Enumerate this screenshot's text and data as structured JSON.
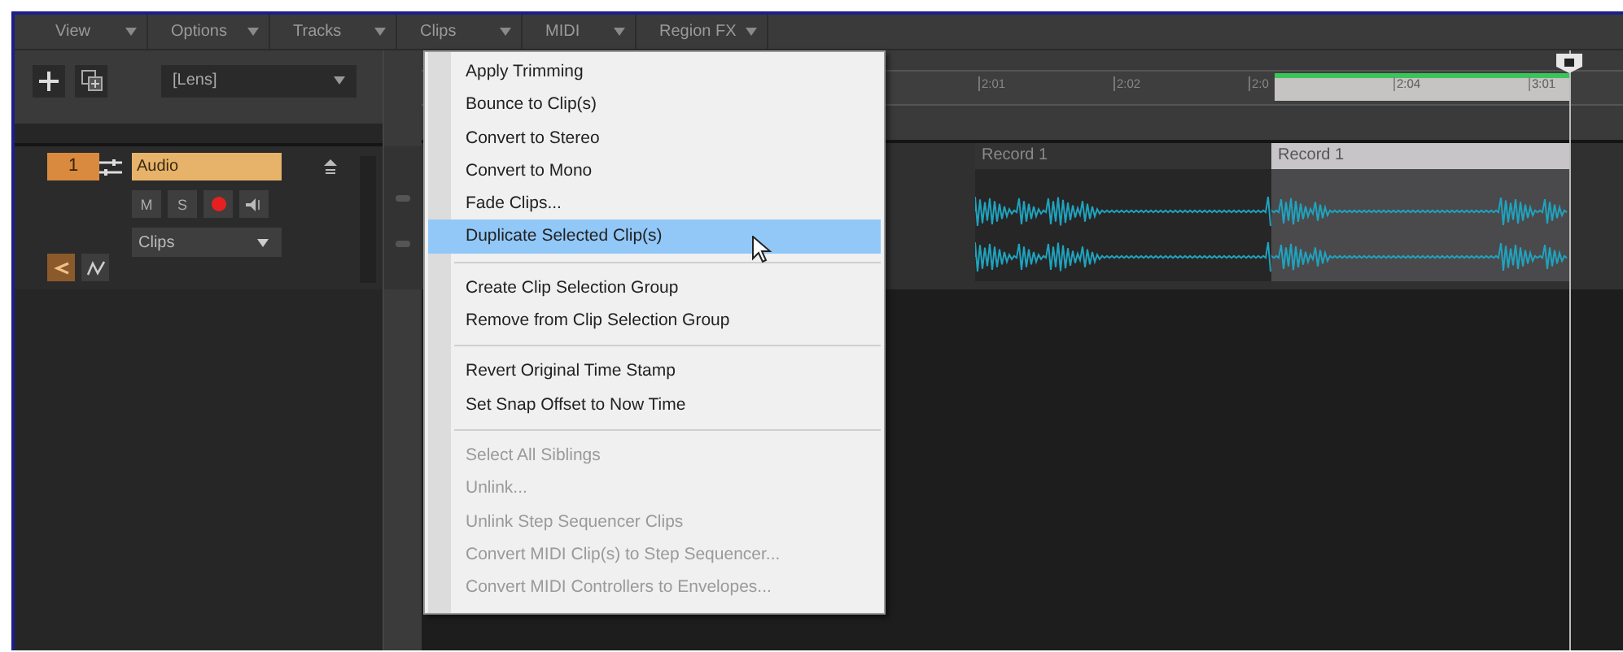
{
  "menubar": [
    {
      "label": "View"
    },
    {
      "label": "Options"
    },
    {
      "label": "Tracks"
    },
    {
      "label": "Clips"
    },
    {
      "label": "MIDI"
    },
    {
      "label": "Region FX"
    }
  ],
  "toolbar": {
    "preset": "[Lens]"
  },
  "track": {
    "number": "1",
    "name": "Audio",
    "buttons": [
      "M",
      "S"
    ],
    "record_armed": true,
    "view": "Clips"
  },
  "ruler": {
    "ticks": [
      "2:01",
      "2:02",
      "2:0",
      "2:04",
      "3:01"
    ]
  },
  "clips": [
    {
      "name": "Record 1",
      "selected": false
    },
    {
      "name": "Record 1",
      "selected": true
    }
  ],
  "context_menu": {
    "items": [
      {
        "kind": "item",
        "label": "Apply Trimming",
        "selected": false,
        "disabled": false
      },
      {
        "kind": "item",
        "label": "Bounce to Clip(s)",
        "selected": false,
        "disabled": false
      },
      {
        "kind": "item",
        "label": "Convert to Stereo",
        "selected": false,
        "disabled": false
      },
      {
        "kind": "item",
        "label": "Convert to Mono",
        "selected": false,
        "disabled": false
      },
      {
        "kind": "item",
        "label": "Fade Clips...",
        "selected": false,
        "disabled": false
      },
      {
        "kind": "item",
        "label": "Duplicate Selected Clip(s)",
        "selected": true,
        "disabled": false
      },
      {
        "kind": "separator"
      },
      {
        "kind": "item",
        "label": "Create Clip Selection Group",
        "selected": false,
        "disabled": false
      },
      {
        "kind": "item",
        "label": "Remove from Clip Selection Group",
        "selected": false,
        "disabled": false
      },
      {
        "kind": "separator"
      },
      {
        "kind": "item",
        "label": "Revert Original Time Stamp",
        "selected": false,
        "disabled": false
      },
      {
        "kind": "item",
        "label": "Set Snap Offset to Now Time",
        "selected": false,
        "disabled": false
      },
      {
        "kind": "separator"
      },
      {
        "kind": "item",
        "label": "Select All Siblings",
        "selected": false,
        "disabled": true
      },
      {
        "kind": "item",
        "label": "Unlink...",
        "selected": false,
        "disabled": true
      },
      {
        "kind": "item",
        "label": "Unlink Step Sequencer Clips",
        "selected": false,
        "disabled": true
      },
      {
        "kind": "item",
        "label": "Convert MIDI Clip(s) to Step Sequencer...",
        "selected": false,
        "disabled": true
      },
      {
        "kind": "item",
        "label": "Convert MIDI Controllers to Envelopes...",
        "selected": false,
        "disabled": true
      }
    ]
  }
}
